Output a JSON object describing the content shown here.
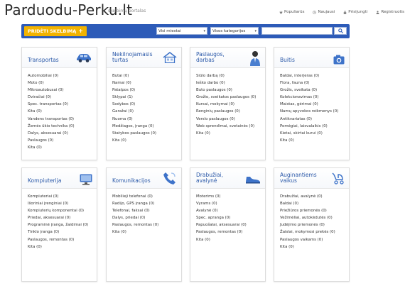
{
  "site": {
    "logo": "Parduodu-Perku.lt",
    "tagline": "skelbimų portalas"
  },
  "topnav": [
    {
      "name": "nav-populiariausi",
      "icon": "star-icon",
      "label": "Populiarūs"
    },
    {
      "name": "nav-naujausi",
      "icon": "clock-icon",
      "label": "Naujausi"
    },
    {
      "name": "nav-prisijungti",
      "icon": "lock-icon",
      "label": "Prisijungti"
    },
    {
      "name": "nav-registruotis",
      "icon": "user-icon",
      "label": "Registruotis"
    }
  ],
  "search": {
    "post_label": "PRIDĖTI SKELBIMĄ",
    "post_icon": "plus",
    "region_value": "Visi miestai",
    "category_value": "Visos kategorijos",
    "query_placeholder": ""
  },
  "categories": [
    {
      "title": "Transportas",
      "icon": "car-icon",
      "items": [
        "Automobiliai (0)",
        "Moto (0)",
        "Mikroautobusai (0)",
        "Dviračiai (0)",
        "Spec. transportas (0)",
        "Kita (0)",
        "Vandens transportas (0)",
        "Žemės ūkio technika (0)",
        "Dalys, aksesuarai (0)",
        "Paslaugos (0)",
        "Kita (0)"
      ]
    },
    {
      "title": "Nekilnojamasis turtas",
      "icon": "house-icon",
      "items": [
        "Butai (0)",
        "Namai (0)",
        "Patalpos (0)",
        "Sklypai (1)",
        "Sodybos (0)",
        "Garažai (0)",
        "Nuoma (0)",
        "Medžiagos, įranga (0)",
        "Statybos paslaugos (0)",
        "Kita (0)"
      ]
    },
    {
      "title": "Paslaugos, darbas",
      "icon": "person-icon",
      "items": [
        "Siūlo darbą (0)",
        "Ieško darbo (0)",
        "Buto paslaugos (0)",
        "Grožio, sveikatos paslaugos (0)",
        "Kursai, mokymai (0)",
        "Renginių paslaugos (0)",
        "Verslo paslaugos (0)",
        "Web sprendimai, svetainės (0)",
        "Kita (0)"
      ]
    },
    {
      "title": "Buitis",
      "icon": "camera-icon",
      "items": [
        "Baldai, interjeras (0)",
        "Flora, fauna (0)",
        "Grožis, sveikata (0)",
        "Kolekcionavimas (0)",
        "Maistas, gėrimai (0)",
        "Namų apyvokos reikmenys (0)",
        "Antikvariatas (0)",
        "Pomėgiai, laisvalaikis (0)",
        "Kietai, skirtai kurui (0)",
        "Kita (0)"
      ]
    },
    {
      "title": "Kompiuterija",
      "icon": "monitor-icon",
      "items": [
        "Kompiuteriai (0)",
        "Išoriniai įrenginiai (0)",
        "Kompiuterių komponentai (0)",
        "Priedai, aksesuarai (0)",
        "Programinė įranga, žaidimai (0)",
        "Tinklo įranga (0)",
        "Paslaugos, remontas (0)",
        "Kita (0)"
      ]
    },
    {
      "title": "Komunikacijos",
      "icon": "phone-icon",
      "items": [
        "Mobilieji telefonai (0)",
        "Radijo, GPS įranga (0)",
        "Telefonai, faksai (0)",
        "Dalys, priedai (0)",
        "Paslaugos, remontas (0)",
        "Kita (0)"
      ]
    },
    {
      "title": "Drabužiai, avalynė",
      "icon": "shoe-icon",
      "items": [
        "Moterims (0)",
        "Vyrams (0)",
        "Avalynė (0)",
        "Spec. apranga (0)",
        "Papuošalai, aksesuarai (0)",
        "Paslaugos, remontas (0)",
        "Kita (0)"
      ]
    },
    {
      "title": "Auginantiems vaikus",
      "icon": "stroller-icon",
      "items": [
        "Drabužiai, avalynė (0)",
        "Baldai (0)",
        "Priežiūros priemonės (0)",
        "Vežimėliai, autokėdutės (0)",
        "Judėjimo priemonės (0)",
        "Žaislai, mokymosi prekės (0)",
        "Paslaugos vaikams (0)",
        "Kita (0)"
      ]
    }
  ]
}
